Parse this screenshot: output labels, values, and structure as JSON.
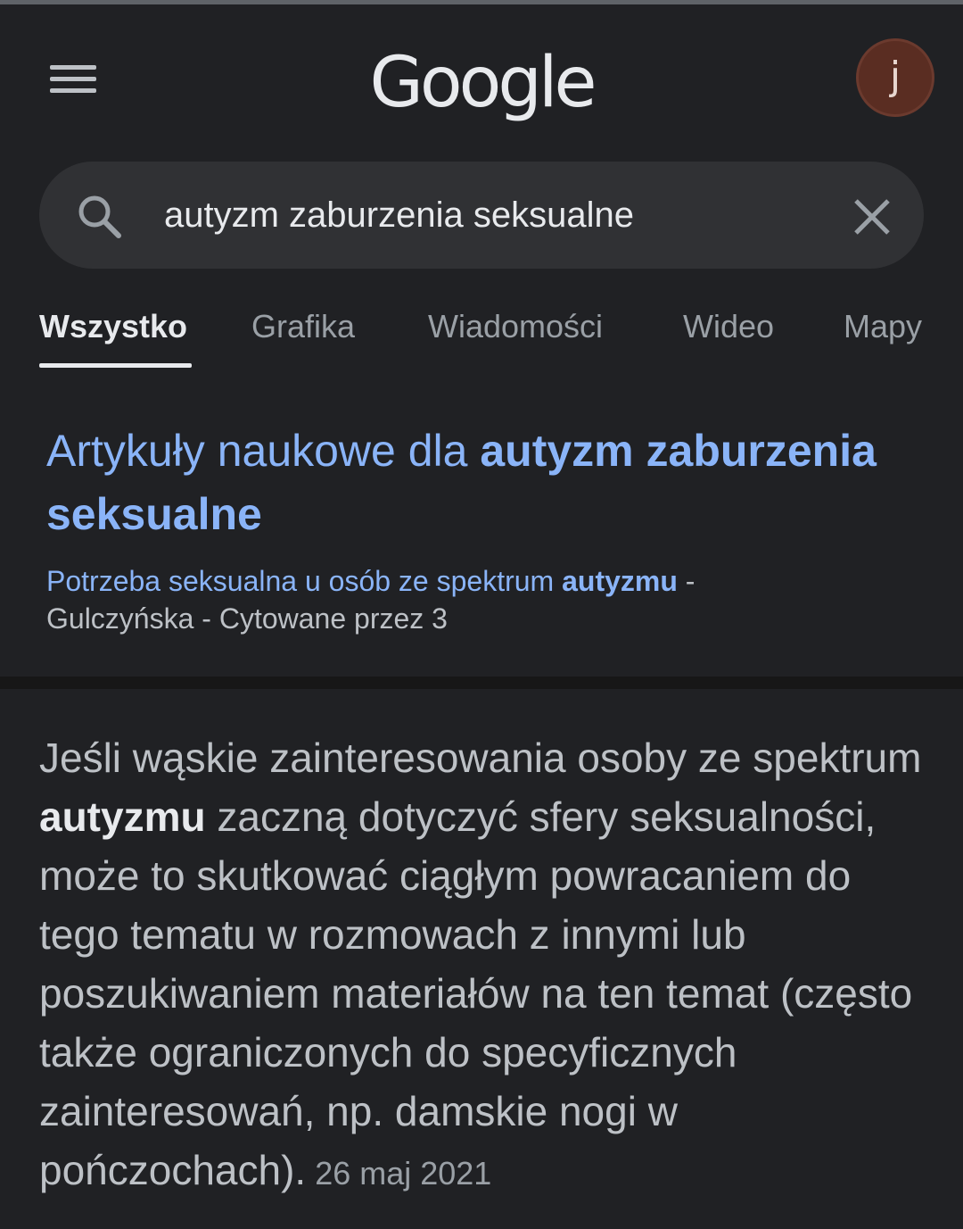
{
  "header": {
    "logo": "Google",
    "avatar_letter": "j"
  },
  "search": {
    "query": "autyzm zaburzenia seksualne"
  },
  "tabs": [
    {
      "label": "Wszystko",
      "active": true
    },
    {
      "label": "Grafika"
    },
    {
      "label": "Wiadomości"
    },
    {
      "label": "Wideo"
    },
    {
      "label": "Mapy"
    }
  ],
  "scholar": {
    "title_prefix": "Artykuły naukowe dla ",
    "title_bold": "autyzm zaburzenia seksualne",
    "link_text": "Potrzeba seksualna u osób ze spektrum ",
    "link_bold": "autyzmu",
    "link_dash": " -",
    "meta": "Gulczyńska - Cytowane przez 3"
  },
  "snippet": {
    "part1": "Jeśli wąskie zainteresowania osoby ze spektrum ",
    "bold": "autyzmu",
    "part2": " zaczną dotyczyć sfery seksualności, może to skutkować ciągłym powracaniem do tego tematu w rozmowach z innymi lub poszukiwaniem materiałów na ten temat (często także ograniczonych do specyficznych zainteresowań, np. damskie nogi w pończochach).",
    "date": "26 maj 2021"
  },
  "colors": {
    "background": "#202124",
    "link": "#8ab4f8",
    "text": "#bdc1c6",
    "avatar": "#5a2d22"
  }
}
